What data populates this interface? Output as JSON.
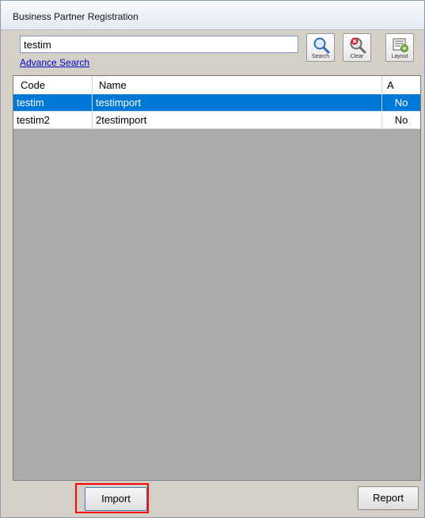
{
  "window": {
    "title": "Business Partner Registration"
  },
  "search": {
    "value": "testim",
    "advance_link": "Advance Search"
  },
  "toolbar": {
    "search_label": "Search",
    "clear_label": "Clear",
    "layout_label": "Layout"
  },
  "grid": {
    "columns": [
      "Code",
      "Name",
      "A"
    ],
    "rows": [
      {
        "code": "testim",
        "name": "testimport",
        "a": "No",
        "selected": true
      },
      {
        "code": "testim2",
        "name": "2testimport",
        "a": "No",
        "selected": false
      }
    ]
  },
  "buttons": {
    "import_label": "Import",
    "report_label": "Report"
  },
  "colors": {
    "selection": "#0078d7",
    "highlight": "#ff0000",
    "link": "#0000cc"
  }
}
